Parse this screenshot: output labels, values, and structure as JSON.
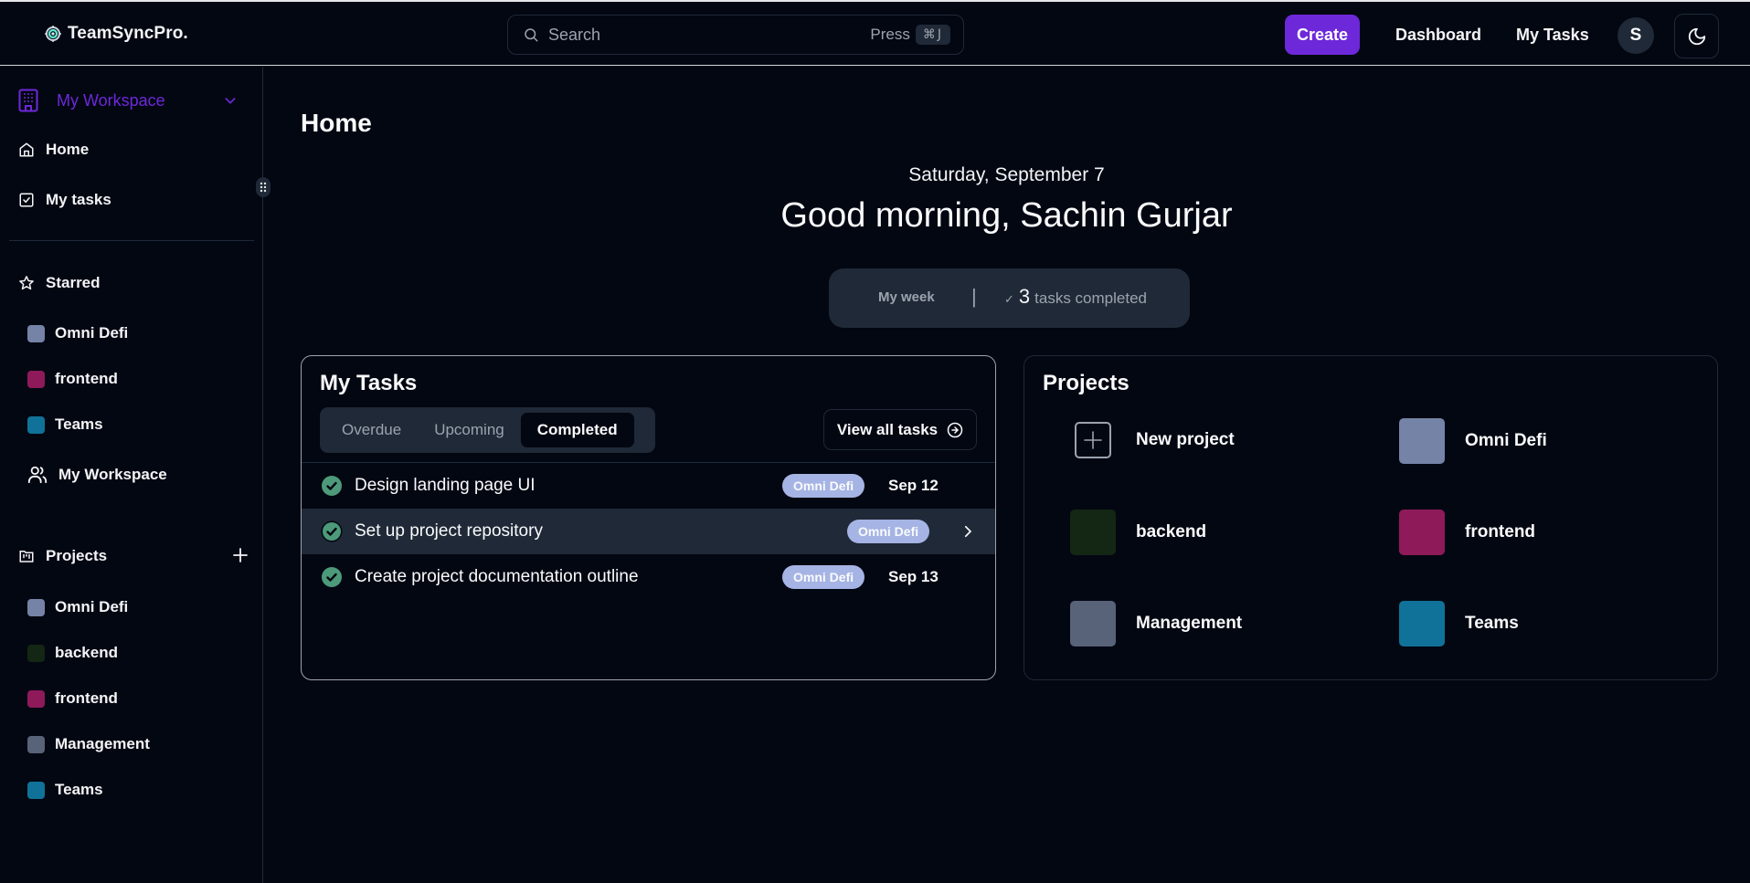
{
  "header": {
    "brand": "TeamSyncPro.",
    "search": {
      "placeholder": "Search",
      "hint": "Press",
      "shortcut": "⌘J"
    },
    "create_label": "Create",
    "nav": [
      "Dashboard",
      "My Tasks"
    ],
    "avatar_initial": "S",
    "accent": "#6d28d9"
  },
  "sidebar": {
    "workspace": {
      "label": "My Workspace"
    },
    "nav": [
      {
        "label": "Home",
        "icon": "home-icon"
      },
      {
        "label": "My tasks",
        "icon": "checkbox-icon"
      }
    ],
    "starred": {
      "label": "Starred",
      "items": [
        {
          "label": "Omni Defi",
          "color": "#7483a6"
        },
        {
          "label": "frontend",
          "color": "#8e1a5a"
        },
        {
          "label": "Teams",
          "color": "#107298"
        }
      ],
      "workspace_link": "My Workspace"
    },
    "projects": {
      "label": "Projects",
      "items": [
        {
          "label": "Omni Defi",
          "color": "#7483a6"
        },
        {
          "label": "backend",
          "color": "#142614"
        },
        {
          "label": "frontend",
          "color": "#8e1a5a"
        },
        {
          "label": "Management",
          "color": "#586278"
        },
        {
          "label": "Teams",
          "color": "#107298"
        }
      ]
    }
  },
  "main": {
    "title": "Home",
    "date": "Saturday, September 7",
    "greeting": "Good morning, Sachin Gurjar",
    "week": {
      "label": "My week",
      "separator": "|",
      "check": "✓",
      "count": "3",
      "text": "tasks completed"
    },
    "tasks_card": {
      "title": "My Tasks",
      "tabs": [
        {
          "label": "Overdue",
          "active": false
        },
        {
          "label": "Upcoming",
          "active": false
        },
        {
          "label": "Completed",
          "active": true
        }
      ],
      "view_all_label": "View all tasks",
      "tasks": [
        {
          "name": "Design landing page UI",
          "project": "Omni Defi",
          "due": "Sep 12",
          "completed": true
        },
        {
          "name": "Set up project repository",
          "project": "Omni Defi",
          "due": "",
          "completed": true
        },
        {
          "name": "Create project documentation outline",
          "project": "Omni Defi",
          "due": "Sep 13",
          "completed": true
        }
      ],
      "check_color": "#4c9a7a",
      "badge_color": "#a5b4e4"
    },
    "projects_card": {
      "title": "Projects",
      "new_label": "New project",
      "items": [
        {
          "label": "Omni Defi",
          "color": "#7483a6"
        },
        {
          "label": "backend",
          "color": "#142614"
        },
        {
          "label": "frontend",
          "color": "#8e1a5a"
        },
        {
          "label": "Management",
          "color": "#586278"
        },
        {
          "label": "Teams",
          "color": "#107298"
        }
      ]
    }
  }
}
